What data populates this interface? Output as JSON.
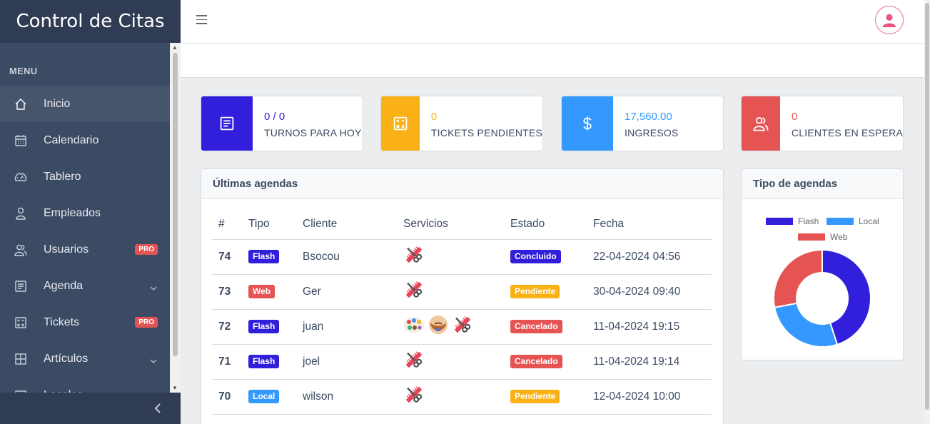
{
  "sidebar": {
    "brand": "Control de Citas",
    "menu_title": "MENU",
    "items": [
      {
        "label": "Inicio",
        "icon": "home-icon",
        "active": true
      },
      {
        "label": "Calendario",
        "icon": "calendar-icon"
      },
      {
        "label": "Tablero",
        "icon": "speedometer-icon"
      },
      {
        "label": "Empleados",
        "icon": "user-icon"
      },
      {
        "label": "Usuarios",
        "icon": "people-icon",
        "badge": "PRO"
      },
      {
        "label": "Agenda",
        "icon": "notes-icon",
        "chevron": true
      },
      {
        "label": "Tickets",
        "icon": "calculator-icon",
        "badge": "PRO"
      },
      {
        "label": "Artículos",
        "icon": "grid-icon",
        "chevron": true
      },
      {
        "label": "Locales",
        "icon": "window-icon"
      }
    ]
  },
  "stats": [
    {
      "value": "0 / 0",
      "label": "TURNOS PARA HOY",
      "color": "#321fdb",
      "icon": "notes-icon"
    },
    {
      "value": "0",
      "label": "TICKETS PENDIENTES",
      "color": "#f9b115",
      "icon": "calculator-icon"
    },
    {
      "value": "17,560.00",
      "label": "INGRESOS",
      "color": "#3399ff",
      "icon": "dollar-icon"
    },
    {
      "value": "0",
      "label": "CLIENTES EN ESPERA",
      "color": "#e55353",
      "icon": "people-icon"
    }
  ],
  "agendas": {
    "title": "Últimas agendas",
    "columns": [
      "#",
      "Tipo",
      "Cliente",
      "Servicios",
      "Estado",
      "Fecha"
    ],
    "rows": [
      {
        "id": "74",
        "tipo": "Flash",
        "cliente": "Bsocou",
        "servicios": [
          "scissors-comb-icon"
        ],
        "estado": "Concluido",
        "fecha": "22-04-2024 04:56"
      },
      {
        "id": "73",
        "tipo": "Web",
        "cliente": "Ger",
        "servicios": [
          "scissors-comb-icon"
        ],
        "estado": "Pendiente",
        "fecha": "30-04-2024 09:40"
      },
      {
        "id": "72",
        "tipo": "Flash",
        "cliente": "juan",
        "servicios": [
          "hair-dye-icon",
          "beard-icon",
          "scissors-comb-icon"
        ],
        "estado": "Cancelado",
        "fecha": "11-04-2024 19:15"
      },
      {
        "id": "71",
        "tipo": "Flash",
        "cliente": "joel",
        "servicios": [
          "scissors-comb-icon"
        ],
        "estado": "Cancelado",
        "fecha": "11-04-2024 19:14"
      },
      {
        "id": "70",
        "tipo": "Local",
        "cliente": "wilson",
        "servicios": [
          "scissors-comb-icon"
        ],
        "estado": "Pendiente",
        "fecha": "12-04-2024 10:00"
      }
    ],
    "tipo_colors": {
      "Flash": "#321fdb",
      "Web": "#e55353",
      "Local": "#3399ff"
    },
    "estado_colors": {
      "Concluido": "#321fdb",
      "Pendiente": "#f9b115",
      "Cancelado": "#e55353"
    }
  },
  "tipo_agendas": {
    "title": "Tipo de agendas",
    "legend": [
      {
        "name": "Flash",
        "color": "#321fdb"
      },
      {
        "name": "Local",
        "color": "#3399ff"
      },
      {
        "name": "Web",
        "color": "#e55353"
      }
    ],
    "shares": [
      0.45,
      0.27,
      0.28
    ]
  }
}
